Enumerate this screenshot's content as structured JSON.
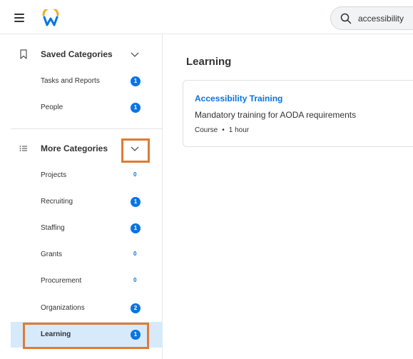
{
  "header": {
    "search_value": "accessibility"
  },
  "sidebar": {
    "saved_categories": {
      "title": "Saved Categories",
      "items": [
        {
          "label": "Tasks and Reports",
          "count": "1"
        },
        {
          "label": "People",
          "count": "1"
        }
      ]
    },
    "more_categories": {
      "title": "More Categories",
      "items": [
        {
          "label": "Projects",
          "count": "0"
        },
        {
          "label": "Recruiting",
          "count": "1"
        },
        {
          "label": "Staffing",
          "count": "1"
        },
        {
          "label": "Grants",
          "count": "0"
        },
        {
          "label": "Procurement",
          "count": "0"
        },
        {
          "label": "Organizations",
          "count": "2"
        },
        {
          "label": "Learning",
          "count": "1",
          "active": true
        }
      ]
    }
  },
  "main": {
    "title": "Learning",
    "result": {
      "title": "Accessibility Training",
      "description": "Mandatory training for AODA requirements",
      "type": "Course",
      "separator": "•",
      "duration": "1 hour"
    }
  },
  "colors": {
    "accent": "#0875e1",
    "highlight": "#e07b33",
    "active_bg": "#d7eafc"
  }
}
